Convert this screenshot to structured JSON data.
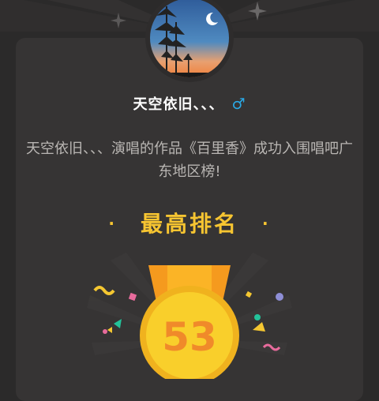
{
  "user": {
    "name": "天空依旧、、、",
    "gender_symbol": "♂",
    "gender": "male"
  },
  "description": "天空依旧、、、演唱的作品《百里香》成功入围唱吧广东地区榜!",
  "rank": {
    "title": "最高排名",
    "bullet": "·",
    "value": "53"
  },
  "icons": {
    "avatar": "avatar-photo-sunset-trees-moon",
    "sparkles": "sparkle-star-icon",
    "medal": "gold-medal-icon",
    "confetti": "confetti-decoration"
  },
  "colors": {
    "background": "#2b2a2a",
    "card": "#363434",
    "accent_gold": "#f7c531",
    "gender_blue": "#2aa9e6",
    "text_secondary": "#b9b6b3",
    "medal_ribbon": "#f59a1e",
    "medal_face": "#f9cf2b",
    "medal_number": "#f08a2a"
  }
}
